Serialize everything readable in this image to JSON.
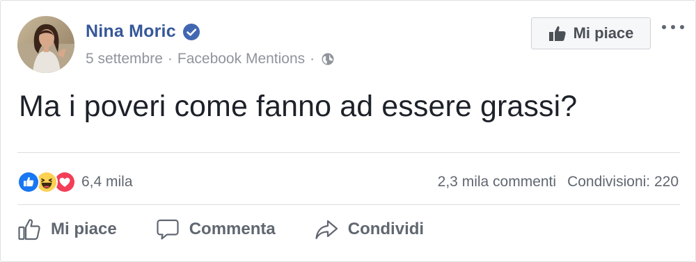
{
  "post": {
    "author": "Nina Moric",
    "date": "5 settembre",
    "source": "Facebook Mentions",
    "separator": "·",
    "text": "Ma i poveri come fanno ad essere grassi?"
  },
  "header": {
    "like_page_label": "Mi piace"
  },
  "stats": {
    "reaction_count": "6,4 mila",
    "comments": "2,3 mila commenti",
    "shares": "Condivisioni: 220"
  },
  "reactions": [
    "like-icon",
    "haha-icon",
    "love-icon"
  ],
  "actions": {
    "like": "Mi piace",
    "comment": "Commenta",
    "share": "Condividi"
  },
  "colors": {
    "brand_blue": "#365899",
    "verified_blue": "#4267b2",
    "like_blue": "#1877f2",
    "love_red": "#f33e58",
    "haha_yellow": "#fcd152",
    "muted_text": "#90949c"
  }
}
